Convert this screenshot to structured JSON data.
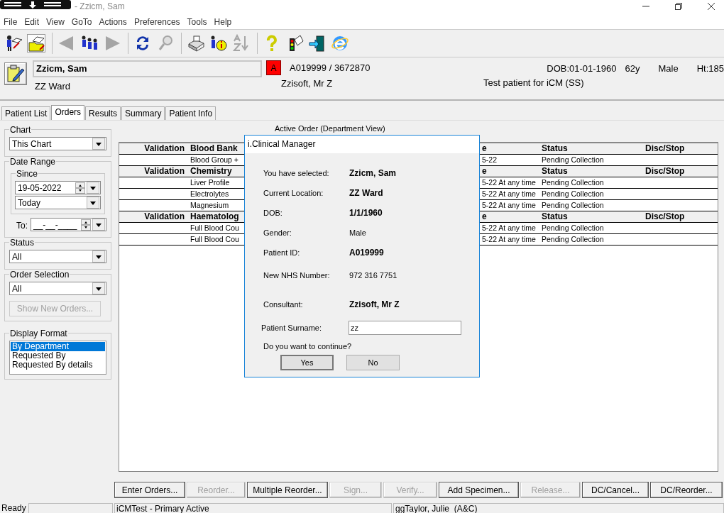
{
  "window": {
    "title": "- Zzicm, Sam"
  },
  "menu": [
    "File",
    "Edit",
    "View",
    "GoTo",
    "Actions",
    "Preferences",
    "Tools",
    "Help"
  ],
  "toolbar": [
    {
      "kind": "patient-book",
      "pressed": false,
      "disabled": false
    },
    {
      "kind": "folder-book",
      "pressed": true,
      "disabled": false
    },
    {
      "kind": "sep"
    },
    {
      "kind": "left",
      "pressed": false,
      "disabled": true
    },
    {
      "kind": "people",
      "pressed": false,
      "disabled": false
    },
    {
      "kind": "right",
      "pressed": false,
      "disabled": true
    },
    {
      "kind": "sep"
    },
    {
      "kind": "refresh",
      "pressed": false,
      "disabled": false
    },
    {
      "kind": "magnifier",
      "pressed": false,
      "disabled": true
    },
    {
      "kind": "sep"
    },
    {
      "kind": "printer",
      "pressed": false,
      "disabled": false
    },
    {
      "kind": "info",
      "pressed": false,
      "disabled": false
    },
    {
      "kind": "sort",
      "pressed": false,
      "disabled": true
    },
    {
      "kind": "sep"
    },
    {
      "kind": "help",
      "pressed": false,
      "disabled": false
    },
    {
      "kind": "traffic",
      "pressed": false,
      "disabled": false
    },
    {
      "kind": "exit",
      "pressed": false,
      "disabled": false
    },
    {
      "kind": "browser",
      "pressed": false,
      "disabled": false
    }
  ],
  "patient": {
    "name": "Zzicm, Sam",
    "ward": "ZZ Ward",
    "alert": "A",
    "ids": "A019999 / 3672870",
    "consultant": "Zzisoft, Mr Z",
    "dob": "DOB:01-01-1960",
    "age": "62y",
    "sex": "Male",
    "height": "Ht:185",
    "note": "Test patient for iCM (SS)"
  },
  "tabs": [
    {
      "label": "Patient List",
      "selected": false
    },
    {
      "label": "Orders",
      "selected": true
    },
    {
      "label": "Results",
      "selected": false
    },
    {
      "label": "Summary",
      "selected": false
    },
    {
      "label": "Patient Info",
      "selected": false
    }
  ],
  "filters": {
    "chart": {
      "title": "Chart",
      "value": "This Chart"
    },
    "date_range": {
      "title": "Date Range",
      "since_title": "Since",
      "since_date": "19-05-2022",
      "since_preset": "Today",
      "to_label": "To:",
      "to_date": "__-__-____"
    },
    "status": {
      "title": "Status",
      "value": "All"
    },
    "order_selection": {
      "title": "Order Selection",
      "value": "All",
      "button": {
        "label": "Show New Orders...",
        "disabled": true
      }
    },
    "display_format": {
      "title": "Display Format",
      "items": [
        {
          "label": "By Department",
          "selected": true
        },
        {
          "label": "Requested By",
          "selected": false
        },
        {
          "label": "Requested By details",
          "selected": false
        }
      ]
    }
  },
  "orders": {
    "title": "Active Order (Department View)",
    "rows": [
      {
        "kind": "header",
        "validation": "Validation",
        "name": "Blood Bank",
        "date": "e",
        "status": "Status",
        "disc": "Disc/Stop"
      },
      {
        "kind": "item",
        "name": "Blood Group +",
        "date": "5-22",
        "status": "Pending Collection"
      },
      {
        "kind": "header",
        "validation": "Validation",
        "name": "Chemistry",
        "date": "e",
        "status": "Status",
        "disc": "Disc/Stop"
      },
      {
        "kind": "item",
        "name": "Liver Profile",
        "date": "5-22 At any time",
        "status": "Pending Collection"
      },
      {
        "kind": "item",
        "name": "Electrolytes",
        "date": "5-22 At any time",
        "status": "Pending Collection"
      },
      {
        "kind": "item",
        "name": "Magnesium",
        "date": "5-22 At any time",
        "status": "Pending Collection"
      },
      {
        "kind": "header",
        "validation": "Validation",
        "name": "Haematolog",
        "date": "e",
        "status": "Status",
        "disc": "Disc/Stop"
      },
      {
        "kind": "item",
        "name": "Full Blood Cou",
        "date": "5-22 At any time",
        "status": "Pending Collection"
      },
      {
        "kind": "item",
        "name": "Full Blood Cou",
        "date": "5-22 At any time",
        "status": "Pending Collection"
      }
    ]
  },
  "actions": [
    {
      "label": "Enter Orders...",
      "disabled": false
    },
    {
      "label": "Reorder...",
      "disabled": true
    },
    {
      "label": "Multiple Reorder...",
      "disabled": false
    },
    {
      "label": "Sign...",
      "disabled": true
    },
    {
      "label": "Verify...",
      "disabled": true
    },
    {
      "label": "Add Specimen...",
      "disabled": false
    },
    {
      "label": "Release...",
      "disabled": true
    },
    {
      "label": "DC/Cancel...",
      "disabled": false
    },
    {
      "label": "DC/Reorder...",
      "disabled": false
    }
  ],
  "status_bar": {
    "state": "Ready",
    "connection": "iCMTest - Primary Active",
    "user": "ggTaylor, Julie  (A&C)"
  },
  "dialog": {
    "title": "i.Clinical Manager",
    "fields": [
      {
        "label": "You have selected:",
        "value": "Zzicm, Sam",
        "bold": true
      },
      {
        "label": "Current Location:",
        "value": "ZZ Ward",
        "bold": true
      },
      {
        "label": "DOB:",
        "value": "1/1/1960",
        "bold": true
      },
      {
        "label": "Gender:",
        "value": "Male",
        "bold": false
      },
      {
        "label": "Patient ID:",
        "value": "A019999",
        "bold": true
      },
      {
        "label": "New NHS Number:",
        "value": "972 316 7751",
        "bold": false
      },
      {
        "label": "Consultant:",
        "value": "Zzisoft, Mr Z",
        "bold": true
      }
    ],
    "input": {
      "label": "Patient Surname:",
      "value": "zz"
    },
    "question": "Do you want to continue?",
    "buttons": [
      {
        "label": "Yes",
        "default": true
      },
      {
        "label": "No",
        "default": false
      }
    ]
  }
}
